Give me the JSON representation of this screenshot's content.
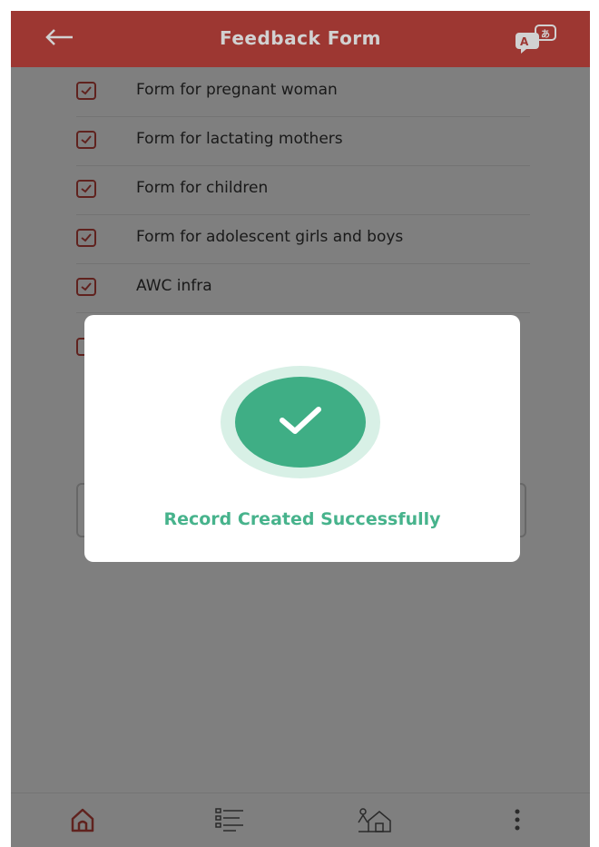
{
  "header": {
    "title": "Feedback Form",
    "back_icon": "arrow-left-icon",
    "translate_icon": "translate-icon"
  },
  "form_items": [
    {
      "label": "Form for pregnant woman",
      "checked": true
    },
    {
      "label": "Form for lactating mothers",
      "checked": true
    },
    {
      "label": "Form for children",
      "checked": true
    },
    {
      "label": "Form for adolescent girls and boys",
      "checked": true
    },
    {
      "label": "AWC infra",
      "checked": true
    }
  ],
  "modal": {
    "icon": "success-check-icon",
    "message": "Record Created Successfully"
  },
  "bottom_nav": {
    "items": [
      "home-icon",
      "list-icon",
      "anganwadi-icon",
      "more-vertical-icon"
    ]
  },
  "colors": {
    "header": "#c0443d",
    "success": "#3fae85",
    "success_text": "#47b38c",
    "checkbox": "#c0443d"
  }
}
